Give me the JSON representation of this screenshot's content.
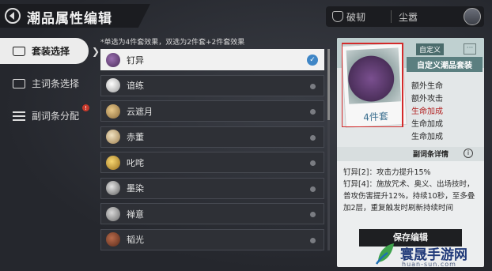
{
  "title": "潮品属性编辑",
  "top_bar": {
    "item1": "破韧",
    "item2": "尘嚣"
  },
  "nav": [
    {
      "label": "套装选择",
      "icon": "shirt-icon",
      "active": true
    },
    {
      "label": "主词条选择",
      "icon": "card-icon",
      "active": false
    },
    {
      "label": "副词条分配",
      "icon": "list-icon",
      "active": false,
      "badge": "!"
    }
  ],
  "hint": "*单选为4件套效果，双选为2件套+2件套效果",
  "items": [
    {
      "label": "钉异",
      "selected": true,
      "icon": "hat-icon"
    },
    {
      "label": "谙练",
      "selected": false,
      "icon": "top-hat-icon"
    },
    {
      "label": "云遮月",
      "selected": false,
      "icon": "paw-icon"
    },
    {
      "label": "赤董",
      "selected": false,
      "icon": "helmet-icon"
    },
    {
      "label": "叱咤",
      "selected": false,
      "icon": "spark-icon"
    },
    {
      "label": "墨染",
      "selected": false,
      "icon": "mask-icon"
    },
    {
      "label": "禅意",
      "selected": false,
      "icon": "bead-icon"
    },
    {
      "label": "韬光",
      "selected": false,
      "icon": "ring-icon"
    }
  ],
  "card": {
    "custom_tag": "自定义",
    "menu": "···",
    "set_name": "自定义潮品套装",
    "piece_caption": "4件套",
    "attributes": [
      {
        "text": "额外生命",
        "highlight": false
      },
      {
        "text": "额外攻击",
        "highlight": false
      },
      {
        "text": "生命加成",
        "highlight": true
      },
      {
        "text": "生命加成",
        "highlight": false
      },
      {
        "text": "生命加成",
        "highlight": false
      }
    ],
    "sub_title": "副词条详情",
    "info_icon": "i",
    "description": "钉异[2]：攻击力提升15%\n钉异[4]：施放咒术、奥义、出场技时，普攻伤害提升12%，持续10秒，至多叠加2层，重复触发时刷新持续时间",
    "save_button": "保存编辑"
  },
  "watermark": {
    "name": "寰晟手游网",
    "url": "huan-sun.com"
  },
  "colors": {
    "selected_check": "#3f86c6",
    "badge": "#c8392b",
    "highlight_text": "#b22222"
  }
}
